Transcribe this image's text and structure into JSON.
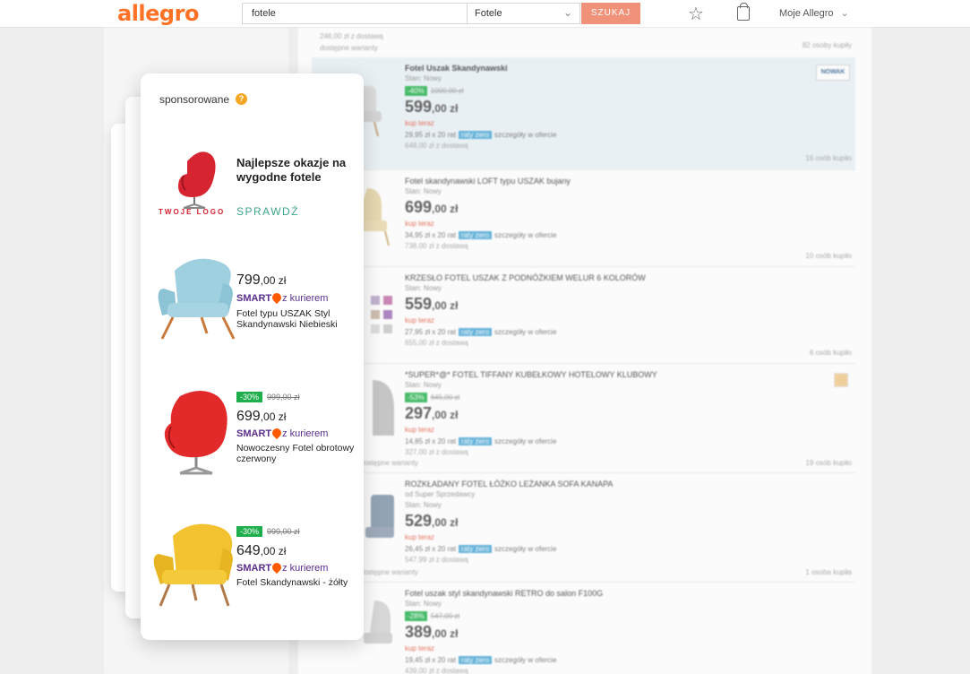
{
  "header": {
    "logo": "allegro",
    "search_value": "fotele",
    "category": "Fotele",
    "search_button": "SZUKAJ",
    "account": "Moje Allegro"
  },
  "top_strip": {
    "price_line": "246,00 zł z dostawą",
    "variants": "dostępne warianty",
    "buyers": "82 osoby kupiły"
  },
  "listings": [
    {
      "title": "Fotel Uszak Skandynawski",
      "state": "Stan: Nowy",
      "discount": "-40%",
      "old_price": "1000,00 zł",
      "price_main": "599",
      "price_dec": ",00 zł",
      "buy": "kup teraz",
      "inst_amount": "29,95 zł x 20 rat",
      "inst_badge": "raty zero",
      "inst_more": "szczegóły w ofercie",
      "delivery": "648,00 zł z dostawą",
      "buyers": "16 osób kupiło",
      "brand": "NOWAK"
    },
    {
      "title": "Fotel skandynawski LOFT typu USZAK bujany",
      "state": "Stan: Nowy",
      "price_main": "699",
      "price_dec": ",00 zł",
      "buy": "kup teraz",
      "inst_amount": "34,95 zł x 20 rat",
      "inst_badge": "raty zero",
      "inst_more": "szczegóły w ofercie",
      "delivery": "738,00 zł z dostawą",
      "buyers": "10 osób kupiło"
    },
    {
      "title": "KRZESŁO FOTEL USZAK Z PODNÓŻKIEM WELUR 6 KOLORÓW",
      "state": "Stan: Nowy",
      "price_main": "559",
      "price_dec": ",00 zł",
      "buy": "kup teraz",
      "inst_amount": "27,95 zł x 20 rat",
      "inst_badge": "raty zero",
      "inst_more": "szczegóły w ofercie",
      "delivery": "655,00 zł z dostawą",
      "buyers": "6 osób kupiło"
    },
    {
      "title": "*SUPER*@* FOTEL TIFFANY KUBEŁKOWY HOTELOWY KLUBOWY",
      "state": "Stan: Nowy",
      "discount": "-53%",
      "old_price": "645,00 zł",
      "price_main": "297",
      "price_dec": ",00 zł",
      "buy": "kup teraz",
      "inst_amount": "14,85 zł x 20 rat",
      "inst_badge": "raty zero",
      "inst_more": "szczegóły w ofercie",
      "delivery": "327,00 zł z dostawą",
      "buyers": "19 osób kupiło",
      "side_left": "dostępne warianty"
    },
    {
      "title": "ROZKŁADANY FOTEL ŁÓŻKO LEŻANKA SOFA KANAPA",
      "seller": "od  Super Sprzedawcy",
      "state": "Stan: Nowy",
      "price_main": "529",
      "price_dec": ",00 zł",
      "buy": "kup teraz",
      "inst_amount": "26,45 zł x 20 rat",
      "inst_badge": "raty zero",
      "inst_more": "szczegóły w ofercie",
      "delivery": "547,99 zł z dostawą",
      "buyers": "1 osoba kupiła",
      "side_left": "dostępne warianty"
    },
    {
      "title": "Fotel uszak styl skandynawski RETRO do salon F100G",
      "state": "Stan: Nowy",
      "discount": "-28%",
      "old_price": "547,00 zł",
      "price_main": "389",
      "price_dec": ",00 zł",
      "buy": "kup teraz",
      "inst_amount": "19,45 zł x 20 rat",
      "inst_badge": "raty zero",
      "inst_more": "szczegóły w ofercie",
      "delivery": "439,00 zł z dostawą"
    }
  ],
  "sponsored": {
    "label": "sponsorowane",
    "help": "?",
    "brand_logo": "TWOJE LOGO",
    "headline": "Najlepsze okazje na wygodne fotele",
    "cta": "SPRAWDŹ",
    "products": [
      {
        "price_main": "799",
        "price_dec": ",00 zł",
        "smart": "SMART",
        "courier": "z kurierem",
        "name": "Fotel typu USZAK Styl Skandynawski Niebieski",
        "color": "#8fc3d6"
      },
      {
        "discount": "-30%",
        "old_price": "999,00 zł",
        "price_main": "699",
        "price_dec": ",00 zł",
        "smart": "SMART",
        "courier": "z kurierem",
        "name": "Nowoczesny Fotel obrotowy czerwony",
        "color": "#e32a2a"
      },
      {
        "discount": "-30%",
        "old_price": "999,00 zł",
        "price_main": "649",
        "price_dec": ",00 zł",
        "smart": "SMART",
        "courier": "z kurierem",
        "name": "Fotel Skandynawski - żółty",
        "color": "#f2c230"
      }
    ]
  },
  "colors": {
    "brand": "#ff5a00",
    "discount": "#1fae4c",
    "smart": "#5a2e8c",
    "cta": "#3fa58c"
  }
}
